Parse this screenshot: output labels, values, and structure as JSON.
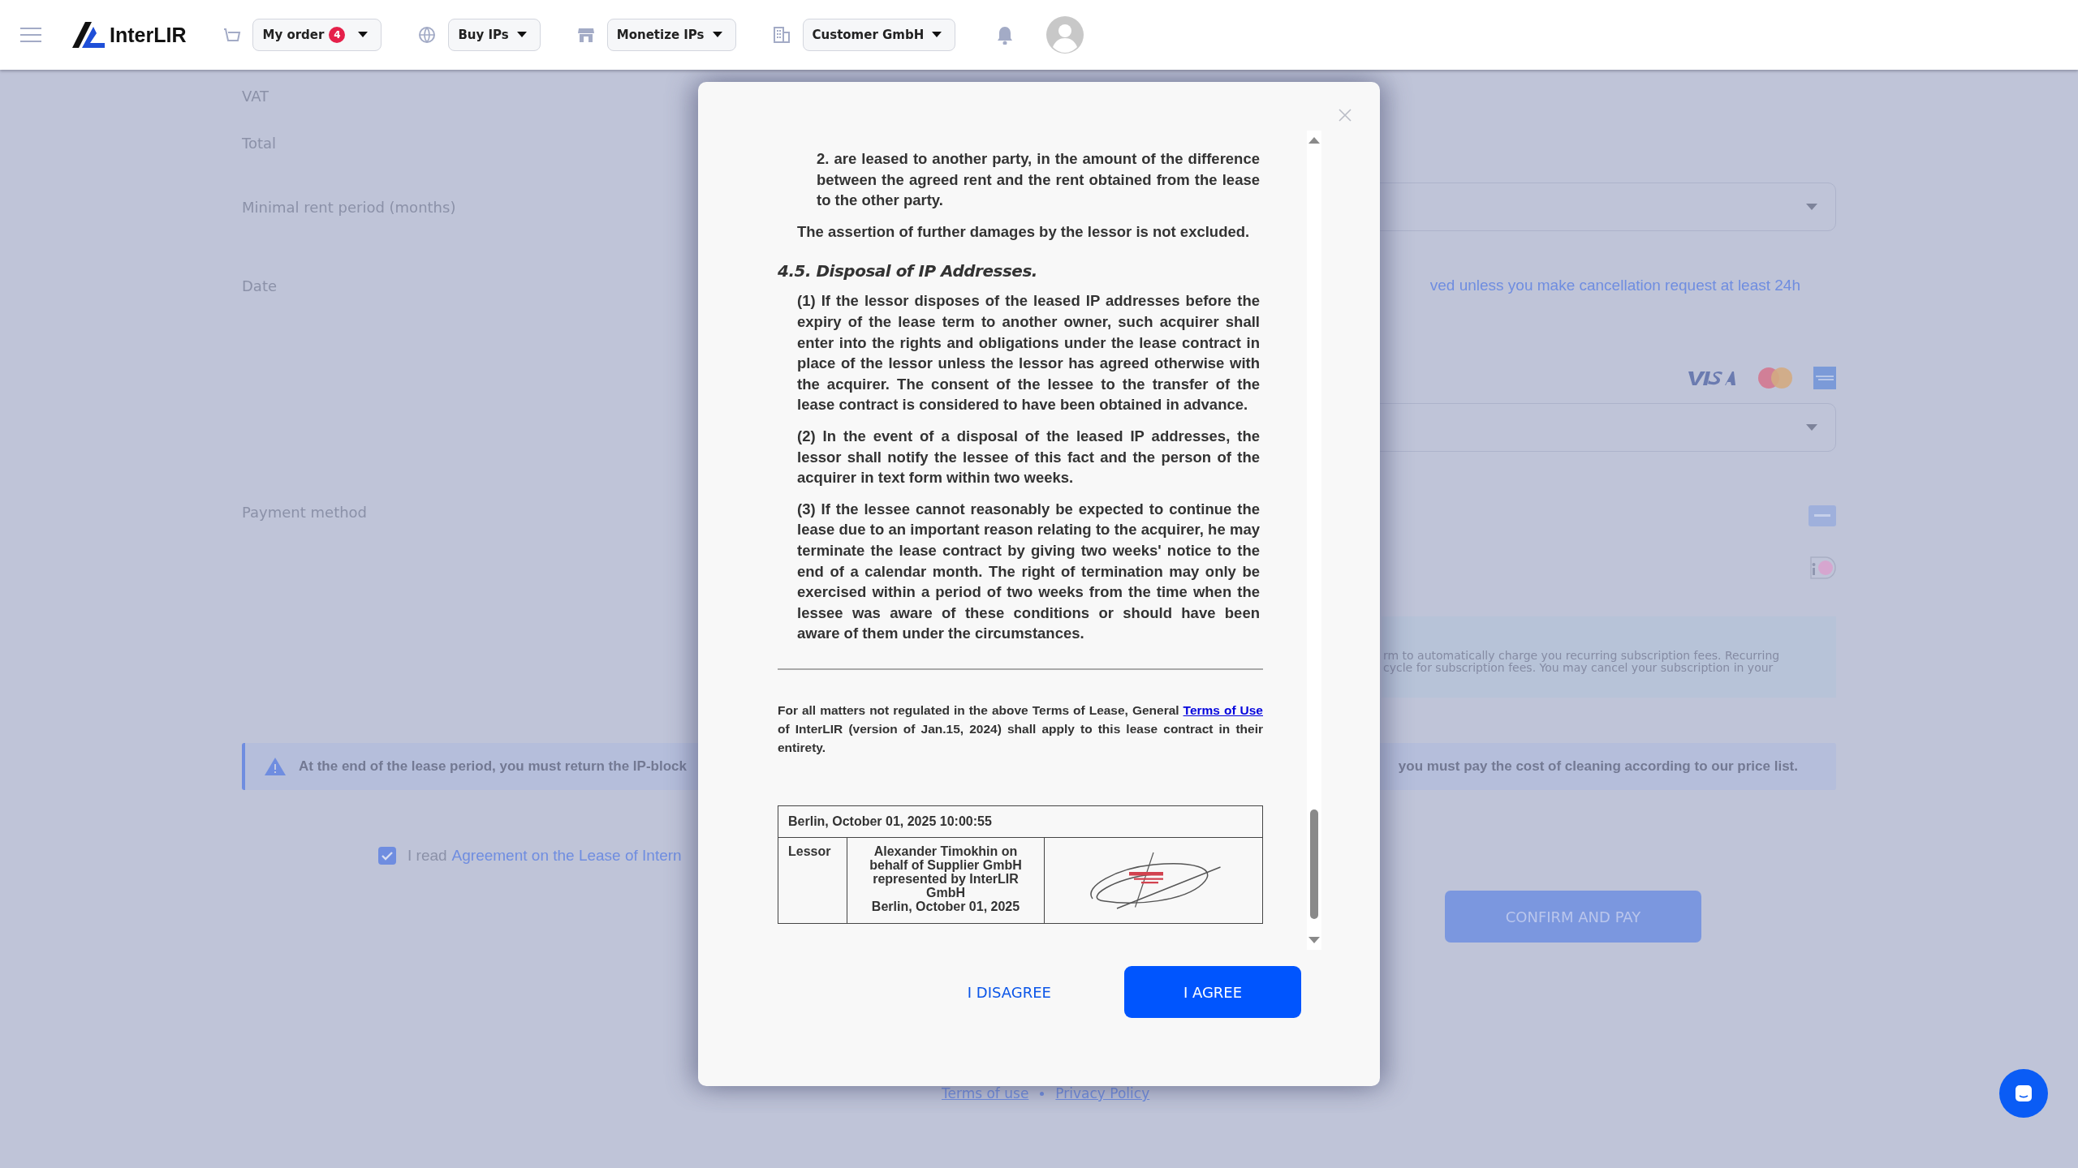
{
  "header": {
    "logo": "InterLIR",
    "nav": [
      {
        "kind": "cart",
        "label": "My order",
        "badge": "4"
      },
      {
        "kind": "globe",
        "label": "Buy IPs"
      },
      {
        "kind": "store",
        "label": "Monetize IPs"
      },
      {
        "kind": "building",
        "label": "Customer GmbH"
      }
    ]
  },
  "form": {
    "vat_label": "VAT",
    "total_label": "Total",
    "rent_period_label": "Minimal rent period (months)",
    "date_label": "Date",
    "date_note": "ved unless you make cancellation request at least 24h",
    "payment_label": "Payment method",
    "recurring_notice": [
      "rm to automatically charge you recurring subscription fees. Recurring",
      "cycle for subscription fees. You may cancel your subscription in your"
    ],
    "alert": [
      "At the end of the lease period, you must return the IP-block",
      "you must pay the cost of cleaning according to our price list."
    ],
    "agreement": {
      "checked": true,
      "text": "I read",
      "link": "Agreement on the Lease of Intern"
    },
    "confirm_button": {
      "label": "CONFIRM AND PAY",
      "disabled": true
    }
  },
  "footer_links": [
    "Terms of use",
    "Privacy Policy"
  ],
  "modal": {
    "sections": [
      {
        "kind": "item",
        "text": "2. are leased to another party, in the amount of the difference between the agreed rent and the rent obtained from the lease to the other party."
      },
      {
        "kind": "para",
        "text": "The assertion of further damages by the lessor is not excluded."
      },
      {
        "kind": "heading",
        "text": "4.5. Disposal of IP Addresses."
      },
      {
        "kind": "para",
        "text": "(1) If the lessor disposes of the leased IP addresses before the expiry of the lease term to another owner, such acquirer shall enter into the rights and obligations under the lease contract in place of the lessor unless the lessor has agreed otherwise with the acquirer. The consent of the lessee to the transfer of the lease contract is considered to have been obtained in advance."
      },
      {
        "kind": "para",
        "text": "(2) In the event of a disposal of the leased IP addresses, the lessor shall notify the lessee of this fact and the person of the acquirer in text form within two weeks."
      },
      {
        "kind": "para",
        "text": "(3) If the lessee cannot reasonably be expected to continue the lease due to an important reason relating to the acquirer, he may terminate the lease contract by giving two weeks' notice to the end of a calendar month. The right of termination may only be exercised within a period of two weeks from the time when the lessee was aware of these conditions or should have been aware of them under the circumstances."
      }
    ],
    "closing": {
      "before": "For all matters not regulated in the above Terms of Lease, General",
      "link": "Terms of Use",
      "after": "of InterLIR (version of Jan.15, 2024) shall apply to this lease contract in their entirety."
    },
    "signature_table": {
      "place_date": "Berlin, October 01, 2025 10:00:55",
      "rows": [
        {
          "role": "Lessor",
          "signer": [
            "Alexander Timokhin on",
            "behalf of Supplier GmbH",
            "represented by InterLIR",
            "GmbH",
            "Berlin, October 01, 2025"
          ]
        }
      ]
    },
    "buttons": [
      {
        "kind": "text",
        "label": "I DISAGREE"
      },
      {
        "kind": "primary",
        "label": "I AGREE"
      }
    ]
  }
}
